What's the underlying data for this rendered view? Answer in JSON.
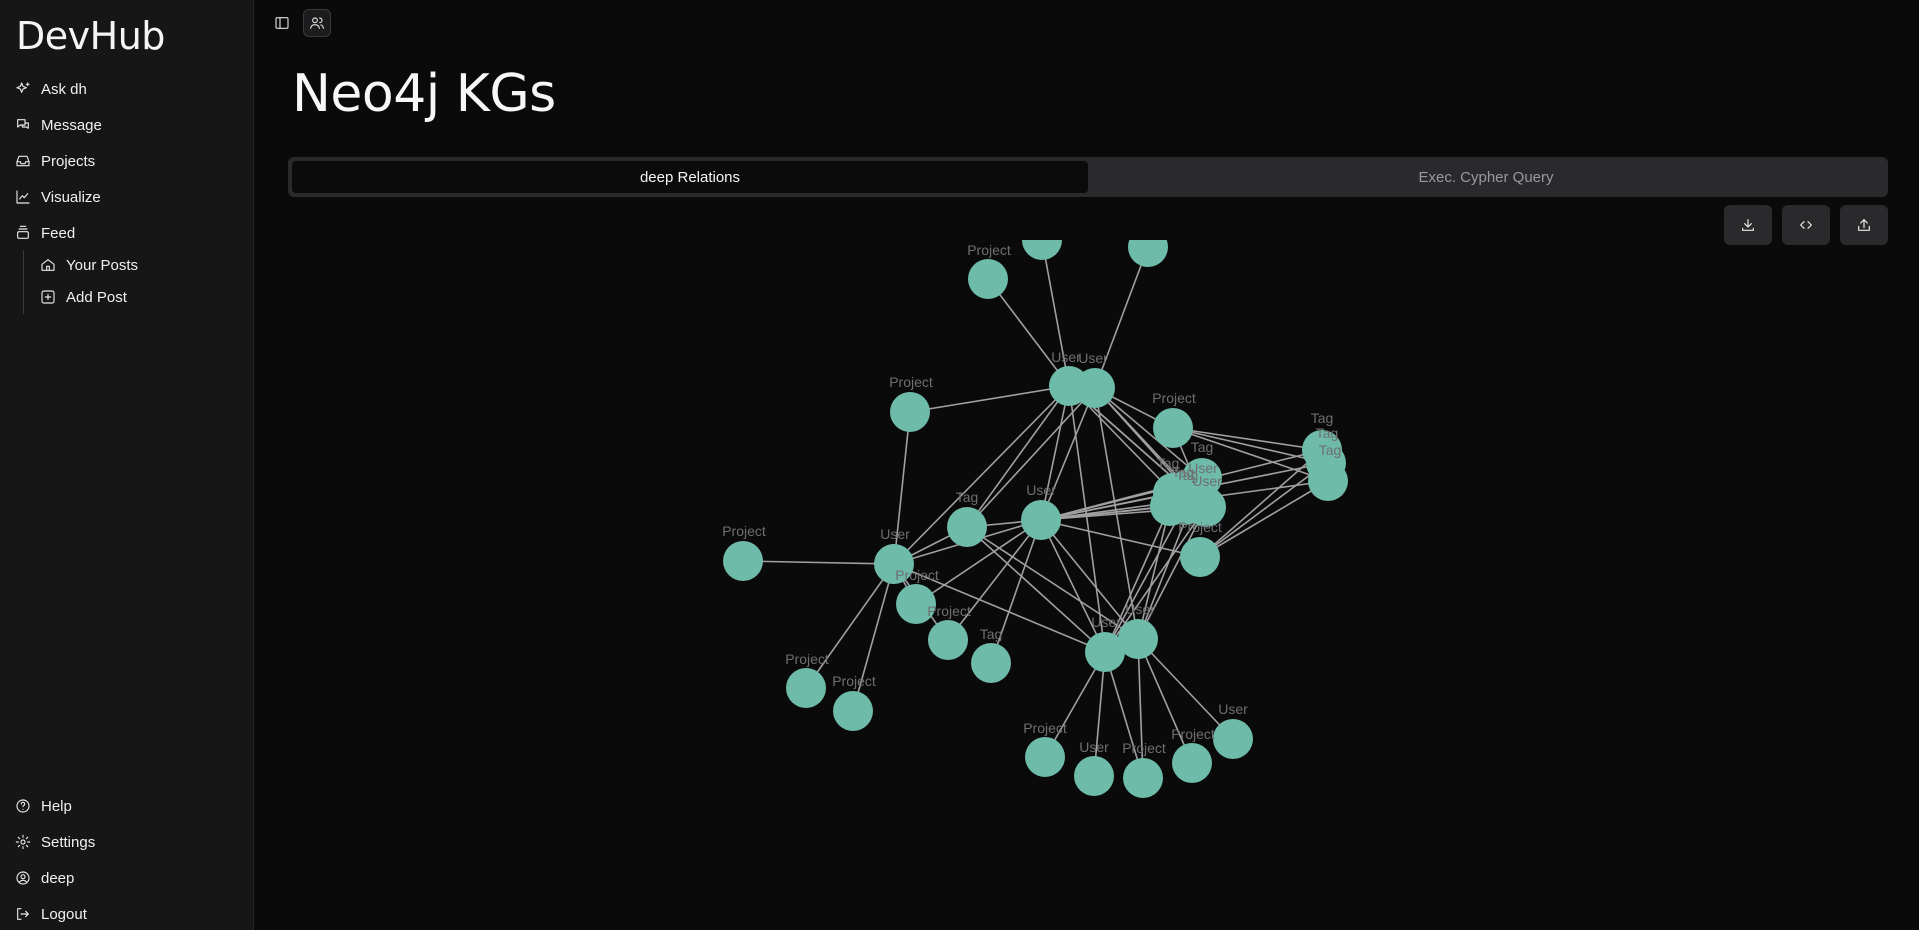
{
  "app": {
    "brand": "DevHub"
  },
  "sidebar": {
    "items": [
      {
        "label": "Ask dh",
        "icon": "sparkles-icon"
      },
      {
        "label": "Message",
        "icon": "messages-icon"
      },
      {
        "label": "Projects",
        "icon": "inbox-icon"
      },
      {
        "label": "Visualize",
        "icon": "chart-icon"
      },
      {
        "label": "Feed",
        "icon": "stack-icon"
      }
    ],
    "sub_items": [
      {
        "label": "Your Posts",
        "icon": "home-icon"
      },
      {
        "label": "Add Post",
        "icon": "plus-square-icon"
      }
    ],
    "bottom_items": [
      {
        "label": "Help",
        "icon": "help-circle-icon"
      },
      {
        "label": "Settings",
        "icon": "gear-icon"
      },
      {
        "label": "deep",
        "icon": "user-circle-icon"
      },
      {
        "label": "Logout",
        "icon": "logout-icon"
      }
    ]
  },
  "page": {
    "title": "Neo4j KGs"
  },
  "tabs": [
    {
      "label": "deep Relations",
      "active": true
    },
    {
      "label": "Exec. Cypher Query",
      "active": false
    }
  ],
  "toolbar": [
    "download-icon",
    "code-icon",
    "share-icon"
  ],
  "graph": {
    "node_color": "#6dbba8",
    "edge_color": "#a0a0a3",
    "nodes": [
      {
        "id": "n1",
        "label": "Project"
      },
      {
        "id": "n2",
        "label": ""
      },
      {
        "id": "n3",
        "label": ""
      },
      {
        "id": "n4",
        "label": "User"
      },
      {
        "id": "n5",
        "label": "User"
      },
      {
        "id": "n6",
        "label": "Project"
      },
      {
        "id": "n7",
        "label": "Project"
      },
      {
        "id": "n8",
        "label": "Tag"
      },
      {
        "id": "n9",
        "label": "Tag"
      },
      {
        "id": "n10",
        "label": "Tag"
      },
      {
        "id": "n11",
        "label": "Tag"
      },
      {
        "id": "n12",
        "label": "Tag"
      },
      {
        "id": "n13",
        "label": "Tag"
      },
      {
        "id": "n14",
        "label": "User"
      },
      {
        "id": "n15",
        "label": "Project"
      },
      {
        "id": "n16",
        "label": "Tag"
      },
      {
        "id": "n17",
        "label": "User"
      },
      {
        "id": "n18",
        "label": "Project"
      },
      {
        "id": "n19",
        "label": "User"
      },
      {
        "id": "n20",
        "label": "Project"
      },
      {
        "id": "n21",
        "label": "Project"
      },
      {
        "id": "n22",
        "label": "Tag"
      },
      {
        "id": "n23",
        "label": "User"
      },
      {
        "id": "n24",
        "label": "User"
      },
      {
        "id": "n25",
        "label": "Project"
      },
      {
        "id": "n26",
        "label": "Project"
      },
      {
        "id": "n27",
        "label": "Project"
      },
      {
        "id": "n28",
        "label": "User"
      },
      {
        "id": "n29",
        "label": "Project"
      },
      {
        "id": "n30",
        "label": "Project"
      },
      {
        "id": "n31",
        "label": "User"
      },
      {
        "id": "n32",
        "label": "Tag"
      },
      {
        "id": "n33",
        "label": "User"
      }
    ],
    "edges": [
      [
        "n1",
        "n4"
      ],
      [
        "n2",
        "n4"
      ],
      [
        "n3",
        "n5"
      ],
      [
        "n6",
        "n4"
      ],
      [
        "n6",
        "n19"
      ],
      [
        "n4",
        "n17"
      ],
      [
        "n5",
        "n17"
      ],
      [
        "n4",
        "n14"
      ],
      [
        "n5",
        "n14"
      ],
      [
        "n4",
        "n33"
      ],
      [
        "n5",
        "n33"
      ],
      [
        "n4",
        "n24"
      ],
      [
        "n5",
        "n23"
      ],
      [
        "n4",
        "n16"
      ],
      [
        "n5",
        "n16"
      ],
      [
        "n4",
        "n19"
      ],
      [
        "n7",
        "n5"
      ],
      [
        "n7",
        "n8"
      ],
      [
        "n7",
        "n9"
      ],
      [
        "n7",
        "n10"
      ],
      [
        "n7",
        "n14"
      ],
      [
        "n8",
        "n17"
      ],
      [
        "n9",
        "n17"
      ],
      [
        "n10",
        "n17"
      ],
      [
        "n10",
        "n15"
      ],
      [
        "n9",
        "n15"
      ],
      [
        "n8",
        "n15"
      ],
      [
        "n17",
        "n12"
      ],
      [
        "n17",
        "n11"
      ],
      [
        "n17",
        "n13"
      ],
      [
        "n17",
        "n32"
      ],
      [
        "n17",
        "n14"
      ],
      [
        "n17",
        "n15"
      ],
      [
        "n17",
        "n16"
      ],
      [
        "n17",
        "n19"
      ],
      [
        "n17",
        "n23"
      ],
      [
        "n17",
        "n24"
      ],
      [
        "n17",
        "n20"
      ],
      [
        "n17",
        "n21"
      ],
      [
        "n17",
        "n22"
      ],
      [
        "n16",
        "n19"
      ],
      [
        "n16",
        "n24"
      ],
      [
        "n16",
        "n23"
      ],
      [
        "n18",
        "n19"
      ],
      [
        "n19",
        "n20"
      ],
      [
        "n19",
        "n21"
      ],
      [
        "n19",
        "n25"
      ],
      [
        "n19",
        "n26"
      ],
      [
        "n19",
        "n24"
      ],
      [
        "n24",
        "n27"
      ],
      [
        "n24",
        "n28"
      ],
      [
        "n24",
        "n29"
      ],
      [
        "n23",
        "n30"
      ],
      [
        "n23",
        "n31"
      ],
      [
        "n23",
        "n29"
      ],
      [
        "n12",
        "n23"
      ],
      [
        "n11",
        "n23"
      ],
      [
        "n13",
        "n24"
      ],
      [
        "n32",
        "n24"
      ],
      [
        "n14",
        "n23"
      ],
      [
        "n14",
        "n24"
      ],
      [
        "n33",
        "n12"
      ],
      [
        "n33",
        "n13"
      ],
      [
        "n4",
        "n12"
      ],
      [
        "n5",
        "n11"
      ]
    ]
  }
}
